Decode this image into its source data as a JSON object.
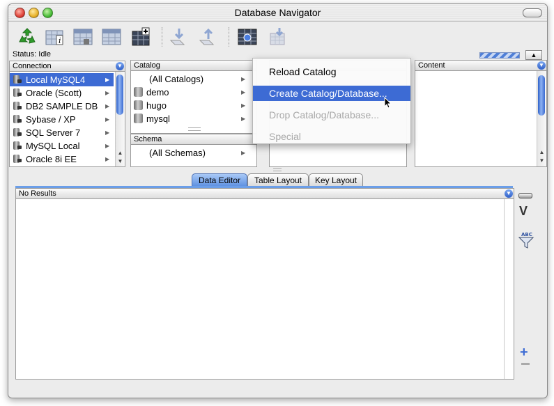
{
  "window": {
    "title": "Database Navigator"
  },
  "status": {
    "text": "Status: Idle"
  },
  "connection": {
    "header": "Connection",
    "items": [
      {
        "label": "Local MySQL4",
        "selected": true
      },
      {
        "label": "Oracle (Scott)"
      },
      {
        "label": "DB2 SAMPLE DB"
      },
      {
        "label": "Sybase / XP"
      },
      {
        "label": "SQL Server 7"
      },
      {
        "label": "MySQL Local"
      },
      {
        "label": "Oracle 8i EE"
      }
    ]
  },
  "catalog": {
    "header": "Catalog",
    "items": [
      "(All Catalogs)",
      "demo",
      "hugo",
      "mysql"
    ]
  },
  "schema": {
    "header": "Schema",
    "items": [
      "(All Schemas)"
    ]
  },
  "content": {
    "header": "Content"
  },
  "context_menu": {
    "items": [
      {
        "label": "Reload Catalog",
        "state": "normal"
      },
      {
        "label": "Create Catalog/Database...",
        "state": "highlighted"
      },
      {
        "label": "Drop Catalog/Database...",
        "state": "disabled"
      },
      {
        "label": "Special",
        "state": "disabled"
      }
    ]
  },
  "tabs": [
    "Data Editor",
    "Table Layout",
    "Key Layout"
  ],
  "results": {
    "header": "No Results"
  },
  "colors": {
    "selection": "#3d6bd4",
    "accent_blue": "#5c8fe0"
  },
  "icons": [
    "refresh-icon",
    "table-info-icon",
    "select-icon",
    "select-alt-icon",
    "table-add-icon",
    "export-icon",
    "import-icon",
    "table-edit-icon",
    "table-delete-icon"
  ]
}
